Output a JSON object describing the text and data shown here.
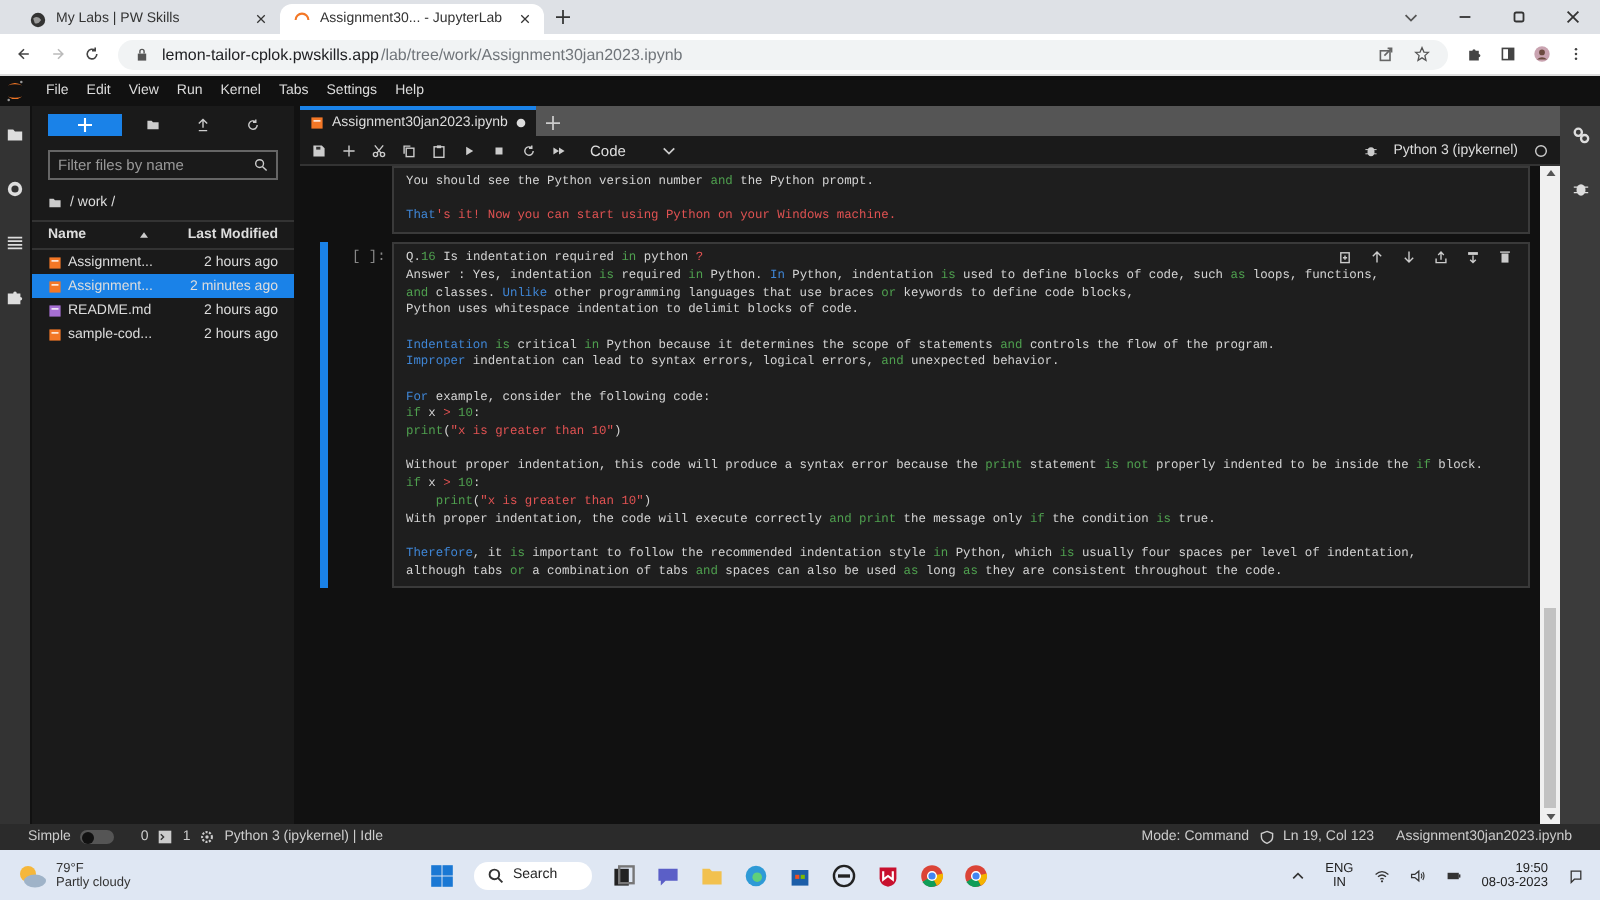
{
  "browser": {
    "tabs": [
      {
        "title": "My Labs | PW Skills",
        "selected": false
      },
      {
        "title": "Assignment30... - JupyterLab",
        "selected": true
      }
    ],
    "address": {
      "host": "lemon-tailor-cplok.pwskills.app",
      "path": "/lab/tree/work/Assignment30jan2023.ipynb"
    }
  },
  "menu": [
    "File",
    "Edit",
    "View",
    "Run",
    "Kernel",
    "Tabs",
    "Settings",
    "Help"
  ],
  "file_browser": {
    "filter": {
      "placeholder": "Filter files by name"
    },
    "path": "/ work /",
    "columns": [
      "Name",
      "Last Modified"
    ],
    "files": [
      {
        "name": "Assignment...",
        "modified": "2 hours ago",
        "kind": "notebook",
        "selected": false
      },
      {
        "name": "Assignment...",
        "modified": "2 minutes ago",
        "kind": "notebook",
        "selected": true
      },
      {
        "name": "README.md",
        "modified": "2 hours ago",
        "kind": "markdown",
        "selected": false
      },
      {
        "name": "sample-cod...",
        "modified": "2 hours ago",
        "kind": "notebook",
        "selected": false
      }
    ]
  },
  "notebook": {
    "tab": {
      "title": "Assignment30jan2023.ipynb",
      "unsaved": true
    },
    "cell_type": "Code",
    "kernel": "Python 3 (ipykernel)",
    "cells": [
      {
        "selected": false,
        "paragraphs": [
          [
            [
              {
                "text": "You should see the Python version number ",
                "kind": "plain"
              },
              {
                "text": "and",
                "kind": "keyword"
              },
              {
                "text": " the Python prompt.",
                "kind": "plain"
              }
            ]
          ],
          [
            [
              {
                "text": "That",
                "kind": "name"
              },
              {
                "text": "'s it! Now you can start using Python on your Windows machine.",
                "kind": "string"
              }
            ]
          ]
        ]
      },
      {
        "selected": true,
        "prompt": "[ ]:",
        "paragraphs": [
          [
            [
              {
                "text": "Q.",
                "kind": "plain"
              },
              {
                "text": "16",
                "kind": "number"
              },
              {
                "text": " Is indentation required ",
                "kind": "plain"
              },
              {
                "text": "in",
                "kind": "keyword"
              },
              {
                "text": " python ",
                "kind": "plain"
              },
              {
                "text": "?",
                "kind": "operator"
              }
            ],
            [
              {
                "text": "Answer : Yes, indentation ",
                "kind": "plain"
              },
              {
                "text": "is",
                "kind": "keyword"
              },
              {
                "text": " required ",
                "kind": "plain"
              },
              {
                "text": "in",
                "kind": "keyword"
              },
              {
                "text": " Python. ",
                "kind": "plain"
              },
              {
                "text": "In",
                "kind": "name"
              },
              {
                "text": " Python, indentation ",
                "kind": "plain"
              },
              {
                "text": "is",
                "kind": "keyword"
              },
              {
                "text": " used to define blocks of code, such ",
                "kind": "plain"
              },
              {
                "text": "as",
                "kind": "keyword"
              },
              {
                "text": " loops, functions,",
                "kind": "plain"
              }
            ],
            [
              {
                "text": "and",
                "kind": "keyword"
              },
              {
                "text": " classes. ",
                "kind": "plain"
              },
              {
                "text": "Unlike",
                "kind": "name"
              },
              {
                "text": " other programming languages that use braces ",
                "kind": "plain"
              },
              {
                "text": "or",
                "kind": "keyword"
              },
              {
                "text": " keywords to define code blocks,",
                "kind": "plain"
              }
            ],
            [
              {
                "text": "Python uses whitespace indentation to delimit blocks of code.",
                "kind": "plain"
              }
            ]
          ],
          [
            [
              {
                "text": "Indentation ",
                "kind": "name"
              },
              {
                "text": "is",
                "kind": "keyword"
              },
              {
                "text": " critical ",
                "kind": "plain"
              },
              {
                "text": "in",
                "kind": "keyword"
              },
              {
                "text": " Python because it determines the scope of statements ",
                "kind": "plain"
              },
              {
                "text": "and",
                "kind": "keyword"
              },
              {
                "text": " controls the flow of the program.",
                "kind": "plain"
              }
            ],
            [
              {
                "text": "Improper",
                "kind": "name"
              },
              {
                "text": " indentation can lead to syntax errors, logical errors, ",
                "kind": "plain"
              },
              {
                "text": "and",
                "kind": "keyword"
              },
              {
                "text": " unexpected behavior.",
                "kind": "plain"
              }
            ]
          ],
          [
            [
              {
                "text": "For",
                "kind": "name"
              },
              {
                "text": " example, consider the following code:",
                "kind": "plain"
              }
            ],
            [
              {
                "text": "if",
                "kind": "keyword"
              },
              {
                "text": " x ",
                "kind": "plain"
              },
              {
                "text": "> ",
                "kind": "operator"
              },
              {
                "text": "10",
                "kind": "number"
              },
              {
                "text": ":",
                "kind": "plain"
              }
            ],
            [
              {
                "text": "print",
                "kind": "keyword"
              },
              {
                "text": "(",
                "kind": "plain"
              },
              {
                "text": "\"x is greater than 10\"",
                "kind": "string"
              },
              {
                "text": ")",
                "kind": "plain"
              }
            ]
          ],
          [
            [
              {
                "text": "Without proper indentation, this code will produce a syntax error because the ",
                "kind": "plain"
              },
              {
                "text": "print",
                "kind": "keyword"
              },
              {
                "text": " statement ",
                "kind": "plain"
              },
              {
                "text": "is not",
                "kind": "keyword"
              },
              {
                "text": " properly indented to be inside the ",
                "kind": "plain"
              },
              {
                "text": "if",
                "kind": "keyword"
              },
              {
                "text": " block.",
                "kind": "plain"
              }
            ],
            [
              {
                "text": "if",
                "kind": "keyword"
              },
              {
                "text": " x ",
                "kind": "plain"
              },
              {
                "text": "> ",
                "kind": "operator"
              },
              {
                "text": "10",
                "kind": "number"
              },
              {
                "text": ":",
                "kind": "plain"
              }
            ],
            [
              {
                "text": "    print",
                "kind": "keyword"
              },
              {
                "text": "(",
                "kind": "plain"
              },
              {
                "text": "\"x is greater than 10\"",
                "kind": "string"
              },
              {
                "text": ")",
                "kind": "plain"
              }
            ],
            [
              {
                "text": "With proper indentation, the code will execute correctly ",
                "kind": "plain"
              },
              {
                "text": "and ",
                "kind": "keyword"
              },
              {
                "text": "print",
                "kind": "keyword"
              },
              {
                "text": " the message only ",
                "kind": "plain"
              },
              {
                "text": "if",
                "kind": "keyword"
              },
              {
                "text": " the condition ",
                "kind": "plain"
              },
              {
                "text": "is",
                "kind": "keyword"
              },
              {
                "text": " true.",
                "kind": "plain"
              }
            ]
          ],
          [
            [
              {
                "text": "Therefore",
                "kind": "name"
              },
              {
                "text": ", it ",
                "kind": "plain"
              },
              {
                "text": "is",
                "kind": "keyword"
              },
              {
                "text": " important to follow the recommended indentation style ",
                "kind": "plain"
              },
              {
                "text": "in",
                "kind": "keyword"
              },
              {
                "text": " Python, which ",
                "kind": "plain"
              },
              {
                "text": "is",
                "kind": "keyword"
              },
              {
                "text": " usually four spaces per level of indentation,",
                "kind": "plain"
              }
            ],
            [
              {
                "text": "although tabs ",
                "kind": "plain"
              },
              {
                "text": "or",
                "kind": "keyword"
              },
              {
                "text": " a combination of tabs ",
                "kind": "plain"
              },
              {
                "text": "and",
                "kind": "keyword"
              },
              {
                "text": " spaces can also be used ",
                "kind": "plain"
              },
              {
                "text": "as",
                "kind": "keyword"
              },
              {
                "text": " long ",
                "kind": "plain"
              },
              {
                "text": "as",
                "kind": "keyword"
              },
              {
                "text": " they are consistent throughout the code.",
                "kind": "plain"
              }
            ]
          ]
        ]
      }
    ]
  },
  "status_bar": {
    "simple_mode": {
      "label": "Simple",
      "on": false
    },
    "terminals": "0",
    "kernels": "1",
    "kernel_status": "Python 3 (ipykernel) | Idle",
    "mode": "Mode: Command",
    "position": "Ln 19, Col 123",
    "file": "Assignment30jan2023.ipynb"
  },
  "taskbar": {
    "weather": {
      "temperature": "79°F",
      "condition": "Partly cloudy"
    },
    "search": "Search",
    "language": [
      "ENG",
      "IN"
    ],
    "time": "19:50",
    "date": "08-03-2023"
  }
}
